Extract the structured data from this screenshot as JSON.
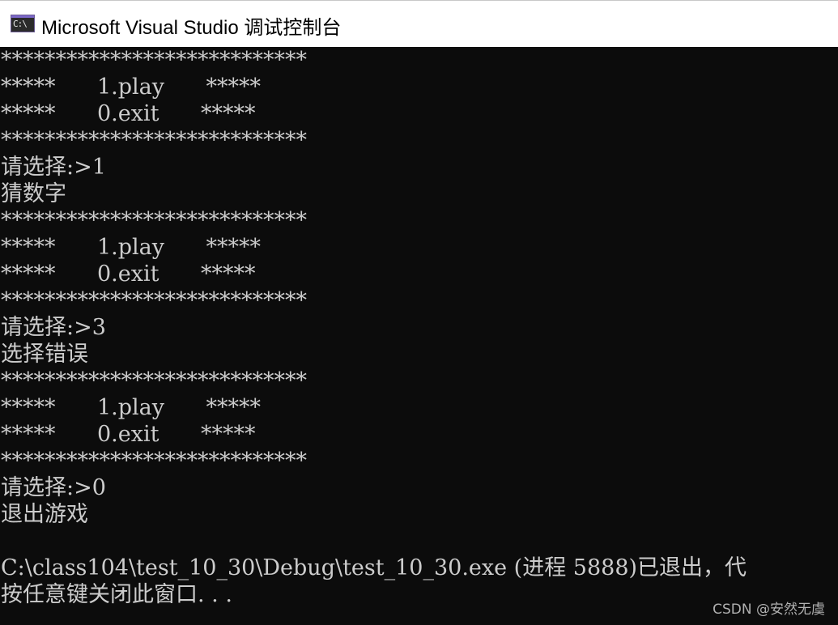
{
  "window": {
    "icon_text": "C:\\",
    "title": "Microsoft Visual Studio 调试控制台"
  },
  "console": {
    "lines": [
      "****************************",
      "*****      1.play      *****",
      "*****      0.exit      *****",
      "****************************",
      "请选择:>1",
      "猜数字",
      "****************************",
      "*****      1.play      *****",
      "*****      0.exit      *****",
      "****************************",
      "请选择:>3",
      "选择错误",
      "****************************",
      "*****      1.play      *****",
      "*****      0.exit      *****",
      "****************************",
      "请选择:>0",
      "退出游戏",
      "",
      "C:\\class104\\test_10_30\\Debug\\test_10_30.exe (进程 5888)已退出，代",
      "按任意键关闭此窗口. . ."
    ]
  },
  "watermark": "CSDN @安然无虞"
}
